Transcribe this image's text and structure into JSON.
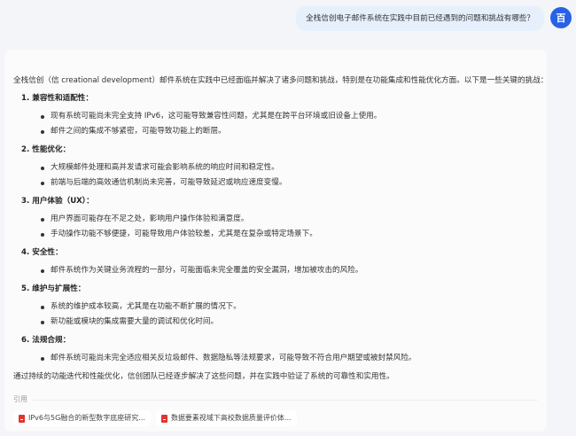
{
  "user_message": "全栈信创电子邮件系统在实践中目前已经遇到的问题和挑战有哪些？",
  "user_avatar": "百",
  "answer": {
    "intro": "全栈信创（信 creational development）邮件系统在实践中已经面临并解决了诸多问题和挑战，特别是在功能集成和性能优化方面。以下是一些关键的挑战：",
    "sections": [
      {
        "title": "1. 兼容性和适配性：",
        "bullets": [
          "现有系统可能尚未完全支持 IPv6，这可能导致兼容性问题，尤其是在跨平台环境或旧设备上使用。",
          "邮件之间的集成不够紧密，可能导致功能上的断层。"
        ]
      },
      {
        "title": "2. 性能优化：",
        "bullets": [
          "大规模邮件处理和高并发请求可能会影响系统的响应时间和稳定性。",
          "前端与后端的高效通信机制尚未完善，可能导致延迟或响应速度变慢。"
        ]
      },
      {
        "title": "3. 用户体验（UX）：",
        "bullets": [
          "用户界面可能存在不足之处，影响用户操作体验和满意度。",
          "手动操作功能不够便捷，可能导致用户体验较差，尤其是在复杂或特定场景下。"
        ]
      },
      {
        "title": "4. 安全性：",
        "bullets": [
          "邮件系统作为关键业务流程的一部分，可能面临未完全覆盖的安全漏洞，增加被攻击的风险。"
        ]
      },
      {
        "title": "5. 维护与扩展性：",
        "bullets": [
          "系统的维护成本较高，尤其是在功能不断扩展的情况下。",
          "新功能或模块的集成需要大量的调试和优化时间。"
        ]
      },
      {
        "title": "6. 法规合规：",
        "bullets": [
          "邮件系统可能尚未完全适应相关反垃圾邮件、数据隐私等法规要求，可能导致不符合用户期望或被封禁风险。"
        ]
      }
    ],
    "outro": "通过持续的功能迭代和性能优化，信创团队已经逐步解决了这些问题，并在实践中验证了系统的可靠性和实用性。"
  },
  "citations": {
    "label": "引用",
    "items": [
      "IPv6与5G融合的新型数字底座研究...",
      "数据要素视域下高校数据质量评价体..."
    ]
  }
}
